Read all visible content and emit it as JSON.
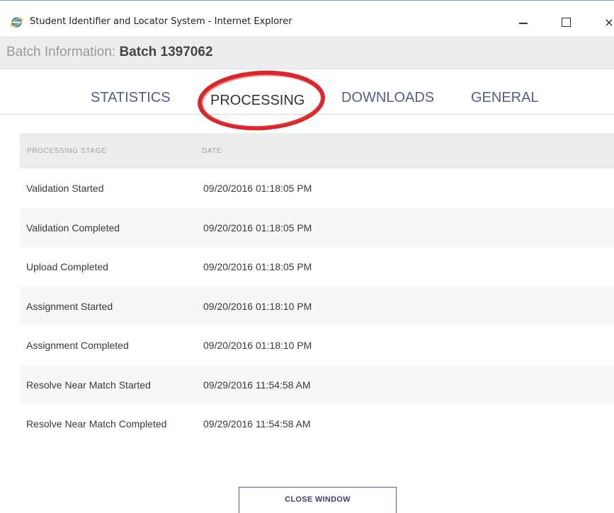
{
  "window": {
    "title": "Student Identifier and Locator System - Internet Explorer",
    "icon": "internet-explorer-icon",
    "controls": {
      "minimize_icon": "minimize-icon",
      "maximize_icon": "maximize-icon",
      "close_label": "×"
    }
  },
  "header": {
    "label": "Batch Information: ",
    "batch": "Batch 1397062"
  },
  "tabs": [
    {
      "label": "STATISTICS",
      "active": false
    },
    {
      "label": "PROCESSING",
      "active": true,
      "highlighted": true
    },
    {
      "label": "DOWNLOADS",
      "active": false
    },
    {
      "label": "GENERAL",
      "active": false
    }
  ],
  "table": {
    "columns": [
      "PROCESSING STAGE",
      "DATE"
    ],
    "rows": [
      {
        "stage": "Validation Started",
        "date": "09/20/2016 01:18:05 PM"
      },
      {
        "stage": "Validation Completed",
        "date": "09/20/2016 01:18:05 PM"
      },
      {
        "stage": "Upload Completed",
        "date": "09/20/2016 01:18:05 PM"
      },
      {
        "stage": "Assignment Started",
        "date": "09/20/2016 01:18:10 PM"
      },
      {
        "stage": "Assignment Completed",
        "date": "09/20/2016 01:18:10 PM"
      },
      {
        "stage": "Resolve Near Match Started",
        "date": "09/29/2016 11:54:58 AM"
      },
      {
        "stage": "Resolve Near Match Completed",
        "date": "09/29/2016 11:54:58 AM"
      }
    ]
  },
  "footer": {
    "close_button": "CLOSE WINDOW"
  },
  "colors": {
    "tab_text": "#5a5c86",
    "highlight_ring": "#d9262a",
    "header_bg": "#ededed"
  }
}
